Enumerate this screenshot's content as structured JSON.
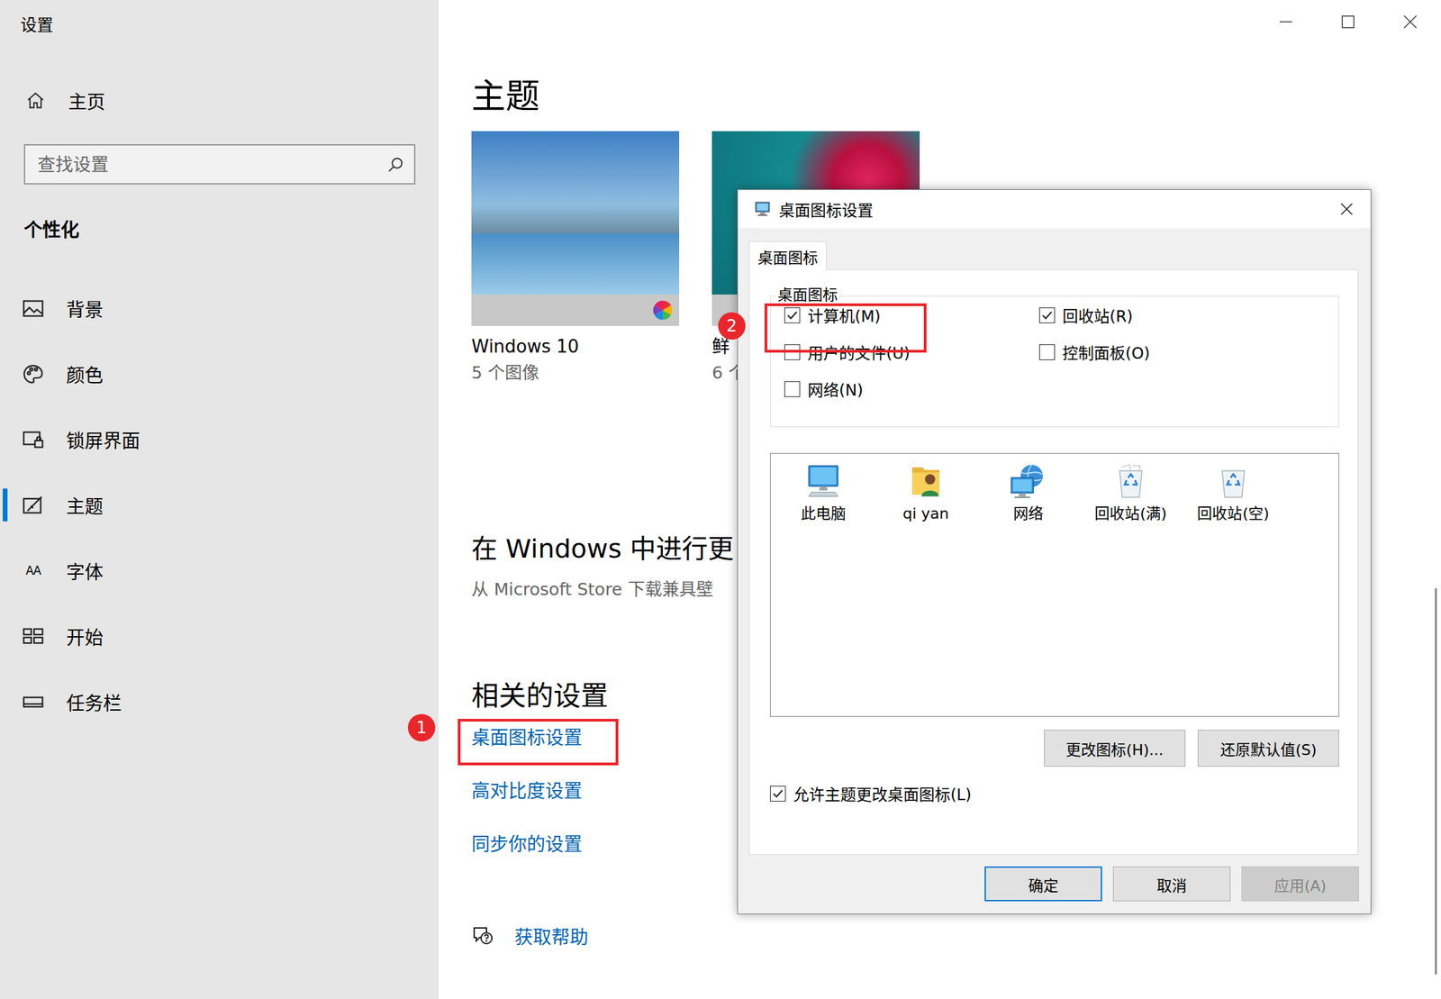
{
  "window": {
    "title": "设置"
  },
  "sidebar": {
    "home": "主页",
    "search": {
      "placeholder": "查找设置"
    },
    "section": "个性化",
    "items": [
      {
        "label": "背景",
        "kind": "background",
        "selected": false
      },
      {
        "label": "颜色",
        "kind": "color",
        "selected": false
      },
      {
        "label": "锁屏界面",
        "kind": "lockscreen",
        "selected": false
      },
      {
        "label": "主题",
        "kind": "theme",
        "selected": true
      },
      {
        "label": "字体",
        "kind": "font",
        "glyph": "AA",
        "selected": false
      },
      {
        "label": "开始",
        "kind": "start",
        "selected": false
      },
      {
        "label": "任务栏",
        "kind": "taskbar",
        "selected": false
      }
    ]
  },
  "page": {
    "title": "主题",
    "themes": [
      {
        "name": "Windows 10",
        "count": "5 个图像",
        "kind": "beach"
      },
      {
        "name": "鲜",
        "count": "6 个",
        "kind": "flower"
      }
    ],
    "more": {
      "title": "在 Windows 中进行更",
      "subtitle": "从 Microsoft Store 下载兼具壁"
    },
    "related": {
      "title": "相关的设置",
      "links": [
        "桌面图标设置",
        "高对比度设置",
        "同步你的设置"
      ]
    },
    "help": "获取帮助"
  },
  "annotations": [
    {
      "label": "1"
    },
    {
      "label": "2"
    }
  ],
  "dialog": {
    "title": "桌面图标设置",
    "tabs": [
      {
        "label": "桌面图标",
        "selected": true
      }
    ],
    "group": {
      "title": "桌面图标",
      "checkboxes": [
        {
          "label": "计算机(M)",
          "checked": true
        },
        {
          "label": "回收站(R)",
          "checked": true
        },
        {
          "label": "用户的文件(U)",
          "checked": false
        },
        {
          "label": "控制面板(O)",
          "checked": false
        },
        {
          "label": "网络(N)",
          "checked": false
        }
      ]
    },
    "icons": [
      {
        "label": "此电脑",
        "kind": "computer"
      },
      {
        "label": "qi yan",
        "kind": "user"
      },
      {
        "label": "网络",
        "kind": "network"
      },
      {
        "label": "回收站(满)",
        "kind": "recycle-full"
      },
      {
        "label": "回收站(空)",
        "kind": "recycle-empty"
      }
    ],
    "icon_buttons": [
      "更改图标(H)...",
      "还原默认值(S)"
    ],
    "allow_theme": {
      "label": "允许主题更改桌面图标(L)",
      "checked": true
    },
    "buttons": [
      {
        "label": "确定",
        "default": true,
        "disabled": false
      },
      {
        "label": "取消",
        "default": false,
        "disabled": false
      },
      {
        "label": "应用(A)",
        "default": false,
        "disabled": true
      }
    ]
  }
}
